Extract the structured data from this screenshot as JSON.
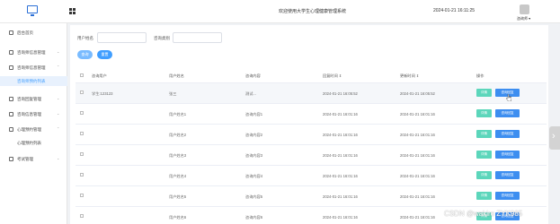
{
  "header": {
    "system_title": "欢迎使用大学生心理健康管理系统",
    "datetime": "2024-01-21 16:11:25",
    "user_name": "咨询师 ▾"
  },
  "sidebar": {
    "items": [
      {
        "label": "后台首页",
        "icon": "home-icon",
        "arrow": ""
      },
      {
        "label": "咨询师信息管理",
        "icon": "user-icon",
        "arrow": "⌄"
      },
      {
        "label": "咨询师信息管理",
        "icon": "doc-icon",
        "arrow": "⌃"
      },
      {
        "label": "咨询师预约列表",
        "icon": "",
        "arrow": ""
      },
      {
        "label": "咨询回复管理",
        "icon": "reply-icon",
        "arrow": "⌄"
      },
      {
        "label": "咨询信息管理",
        "icon": "info-icon",
        "arrow": "⌄"
      },
      {
        "label": "心理预约管理",
        "icon": "calendar-icon",
        "arrow": "⌃"
      },
      {
        "label": "心理预约列表",
        "icon": "",
        "arrow": ""
      },
      {
        "label": "考试管理",
        "icon": "exam-icon",
        "arrow": "⌄"
      }
    ]
  },
  "filters": {
    "field1_label": "用户姓名",
    "field1_value": "",
    "field2_label": "咨询类别",
    "field2_value": "",
    "search_label": "查询",
    "reset_label": "重置"
  },
  "table": {
    "columns": [
      "咨询用户",
      "用户姓名",
      "咨询内容",
      "回复时间 ⇕",
      "更新时间 ⇕",
      "操作"
    ],
    "rows": [
      [
        "学生:123123",
        "张三",
        "测试...",
        "2024-01-21 16:05:52",
        "2024-01-21 16:05:52"
      ],
      [
        "",
        "用户姓名1",
        "咨询内容1",
        "2024-01-21 16:01:16",
        "2024-01-21 16:01:16"
      ],
      [
        "",
        "用户姓名2",
        "咨询内容2",
        "2024-01-21 16:01:16",
        "2024-01-21 16:01:16"
      ],
      [
        "",
        "用户姓名3",
        "咨询内容3",
        "2024-01-21 16:01:16",
        "2024-01-21 16:01:16"
      ],
      [
        "",
        "用户姓名4",
        "咨询内容4",
        "2024-01-21 16:01:16",
        "2024-01-21 16:01:16"
      ],
      [
        "",
        "用户姓名5",
        "咨询内容5",
        "2024-01-21 16:01:16",
        "2024-01-21 16:01:16"
      ],
      [
        "",
        "用户姓名6",
        "咨询内容6",
        "2024-01-21 16:01:16",
        "2024-01-21 16:01:16"
      ]
    ],
    "detail_label": "详情",
    "delete_label": "咨询回复"
  },
  "watermark": "CSDN @wakiro ZYK985",
  "colors": {
    "primary": "#409eff",
    "detail_button": "#5cd6bb",
    "delete_button": "#3d8ef0",
    "active_bg": "#e8f1fd"
  }
}
